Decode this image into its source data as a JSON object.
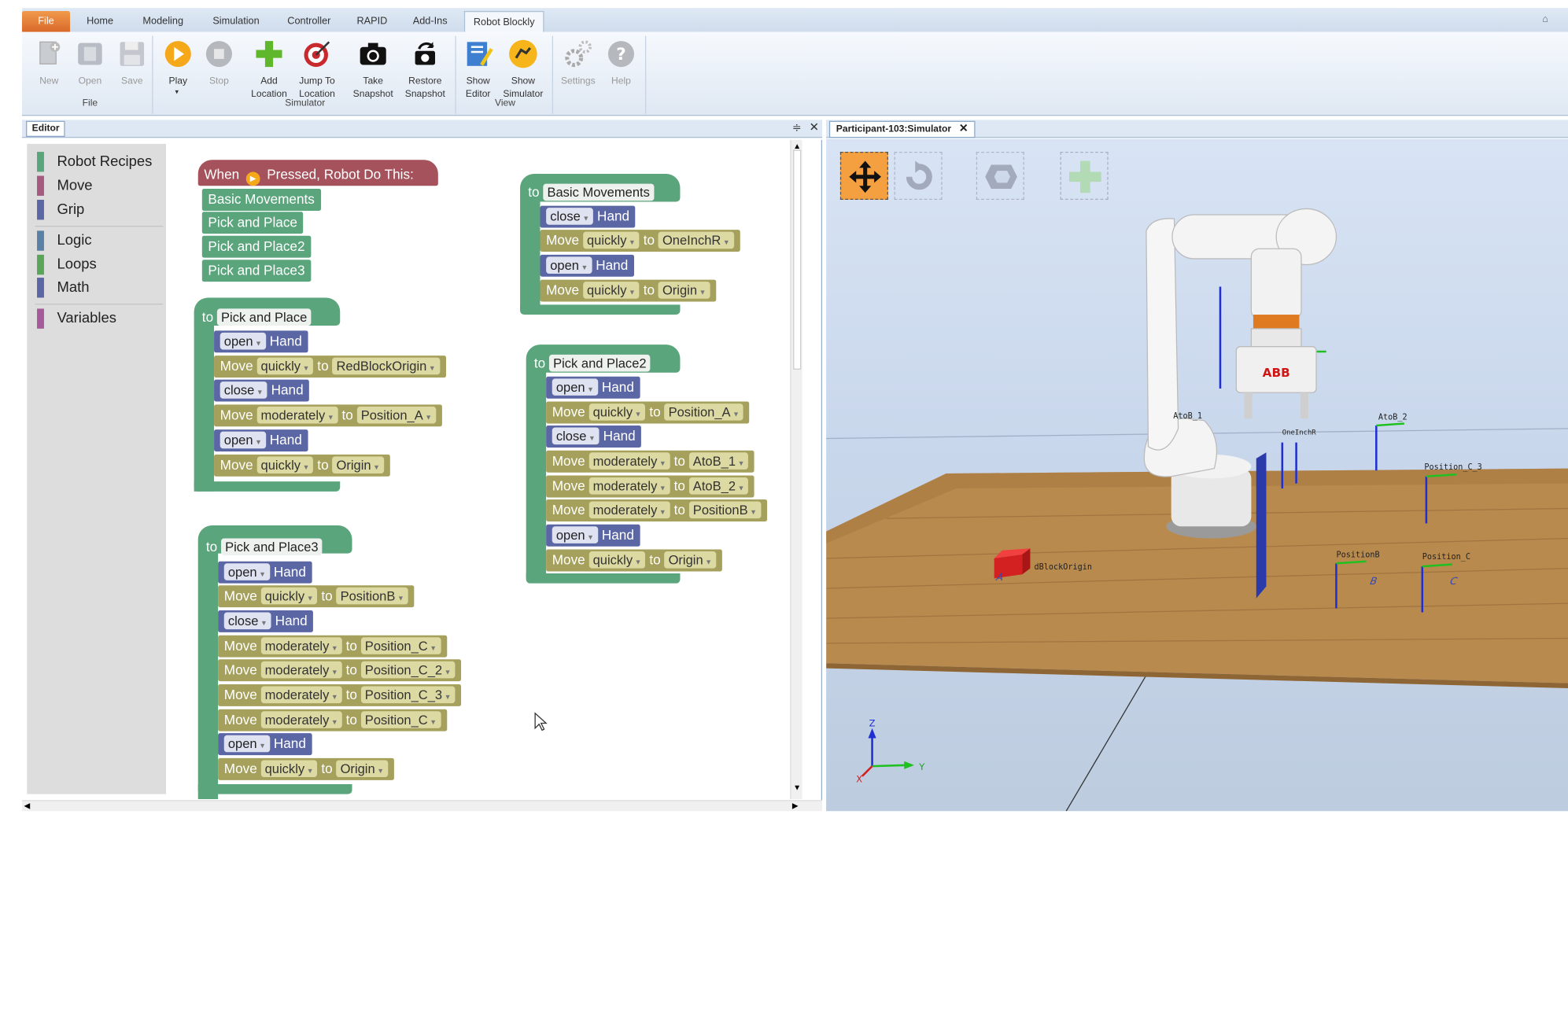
{
  "ribbon": {
    "tabs": [
      "File",
      "Home",
      "Modeling",
      "Simulation",
      "Controller",
      "RAPID",
      "Add-Ins",
      "Robot Blockly"
    ],
    "buttons": {
      "new": "New",
      "open": "Open",
      "save": "Save",
      "play": "Play",
      "stop": "Stop",
      "add_location_1": "Add",
      "add_location_2": "Location",
      "jump_1": "Jump To",
      "jump_2": "Location",
      "take_1": "Take",
      "take_2": "Snapshot",
      "restore_1": "Restore",
      "restore_2": "Snapshot",
      "show_editor_1": "Show",
      "show_editor_2": "Editor",
      "show_sim_1": "Show",
      "show_sim_2": "Simulator",
      "settings": "Settings",
      "help": "Help"
    },
    "groups": {
      "file": "File",
      "simulator": "Simulator",
      "view": "View"
    }
  },
  "editor": {
    "tab": "Editor",
    "categories": [
      "Robot Recipes",
      "Move",
      "Grip",
      "Logic",
      "Loops",
      "Math",
      "Variables"
    ],
    "category_colors": [
      "#5ba57d",
      "#a55b80",
      "#5b67a5",
      "#5b80a5",
      "#5ba55b",
      "#5b67a5",
      "#a55b99"
    ]
  },
  "blocks": {
    "when": {
      "prefix": "When",
      "suffix": "Pressed, Robot Do This:"
    },
    "calls": [
      "Basic Movements",
      "Pick and Place",
      "Pick and Place2",
      "Pick and Place3"
    ],
    "to": "to",
    "hand": "Hand",
    "move": "Move",
    "open": "open",
    "close": "close",
    "quickly": "quickly",
    "moderately": "moderately",
    "proc_basic": {
      "name": "Basic Movements",
      "targets": [
        "OneInchR",
        "Origin"
      ]
    },
    "proc_pp": {
      "name": "Pick and Place",
      "targets": [
        "RedBlockOrigin",
        "Position_A",
        "Origin"
      ]
    },
    "proc_pp2": {
      "name": "Pick and Place2",
      "targets": [
        "Position_A",
        "AtoB_1",
        "AtoB_2",
        "PositionB",
        "Origin"
      ]
    },
    "proc_pp3": {
      "name": "Pick and Place3",
      "targets": [
        "PositionB",
        "Position_C",
        "Position_C_2",
        "Position_C_3",
        "Position_C",
        "Origin"
      ]
    }
  },
  "simulator": {
    "tab": "Participant-103:Simulator",
    "labels": [
      "AtoB_1",
      "AtoB_2",
      "Position_C_3",
      "PositionB",
      "Position_C",
      "dBlockOrigin",
      "A",
      "B",
      "C",
      "OneInchR"
    ],
    "axes": {
      "z": "Z",
      "y": "Y",
      "x": "X"
    },
    "brand": "ABB"
  }
}
